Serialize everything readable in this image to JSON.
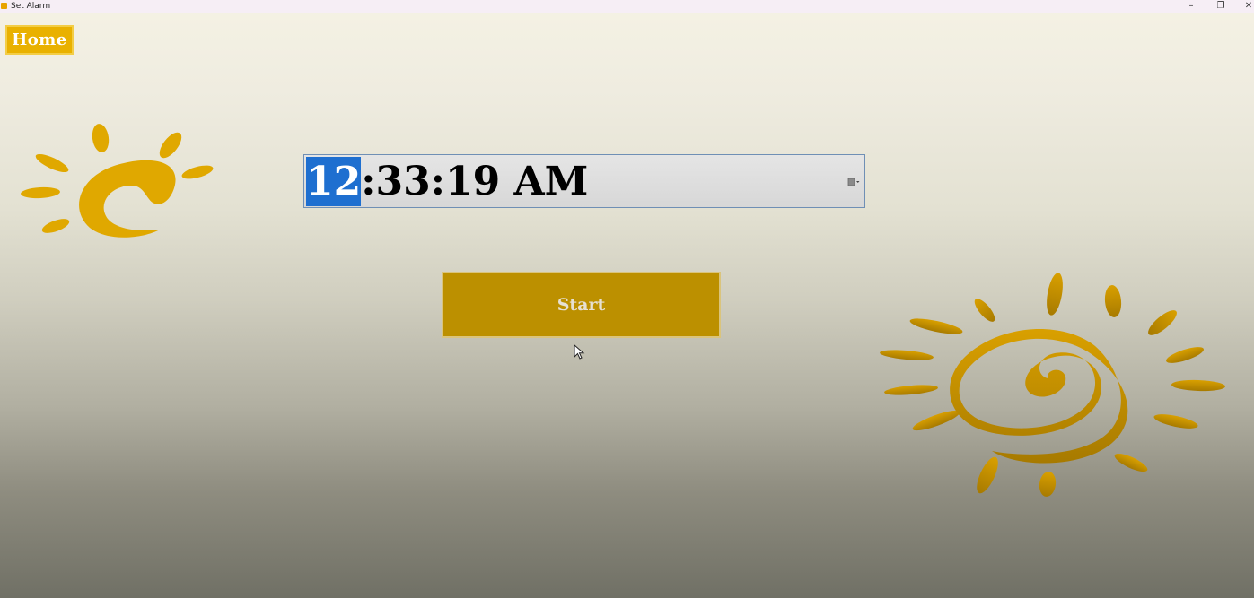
{
  "window": {
    "title": "Set Alarm",
    "controls": {
      "minimize": "–",
      "maximize": "❐",
      "close": "✕"
    }
  },
  "nav": {
    "home_label": "Home"
  },
  "time_picker": {
    "hour": "12",
    "rest": ":33:19 AM"
  },
  "actions": {
    "start_label": "Start"
  },
  "colors": {
    "accent": "#e9b100",
    "button": "#bc9000",
    "sun": "#e0a800",
    "selection": "#1e6fd0"
  },
  "icons": [
    "app-icon",
    "sun-icon",
    "sun-spiral-icon",
    "dropdown-icon",
    "mouse-cursor-icon"
  ]
}
